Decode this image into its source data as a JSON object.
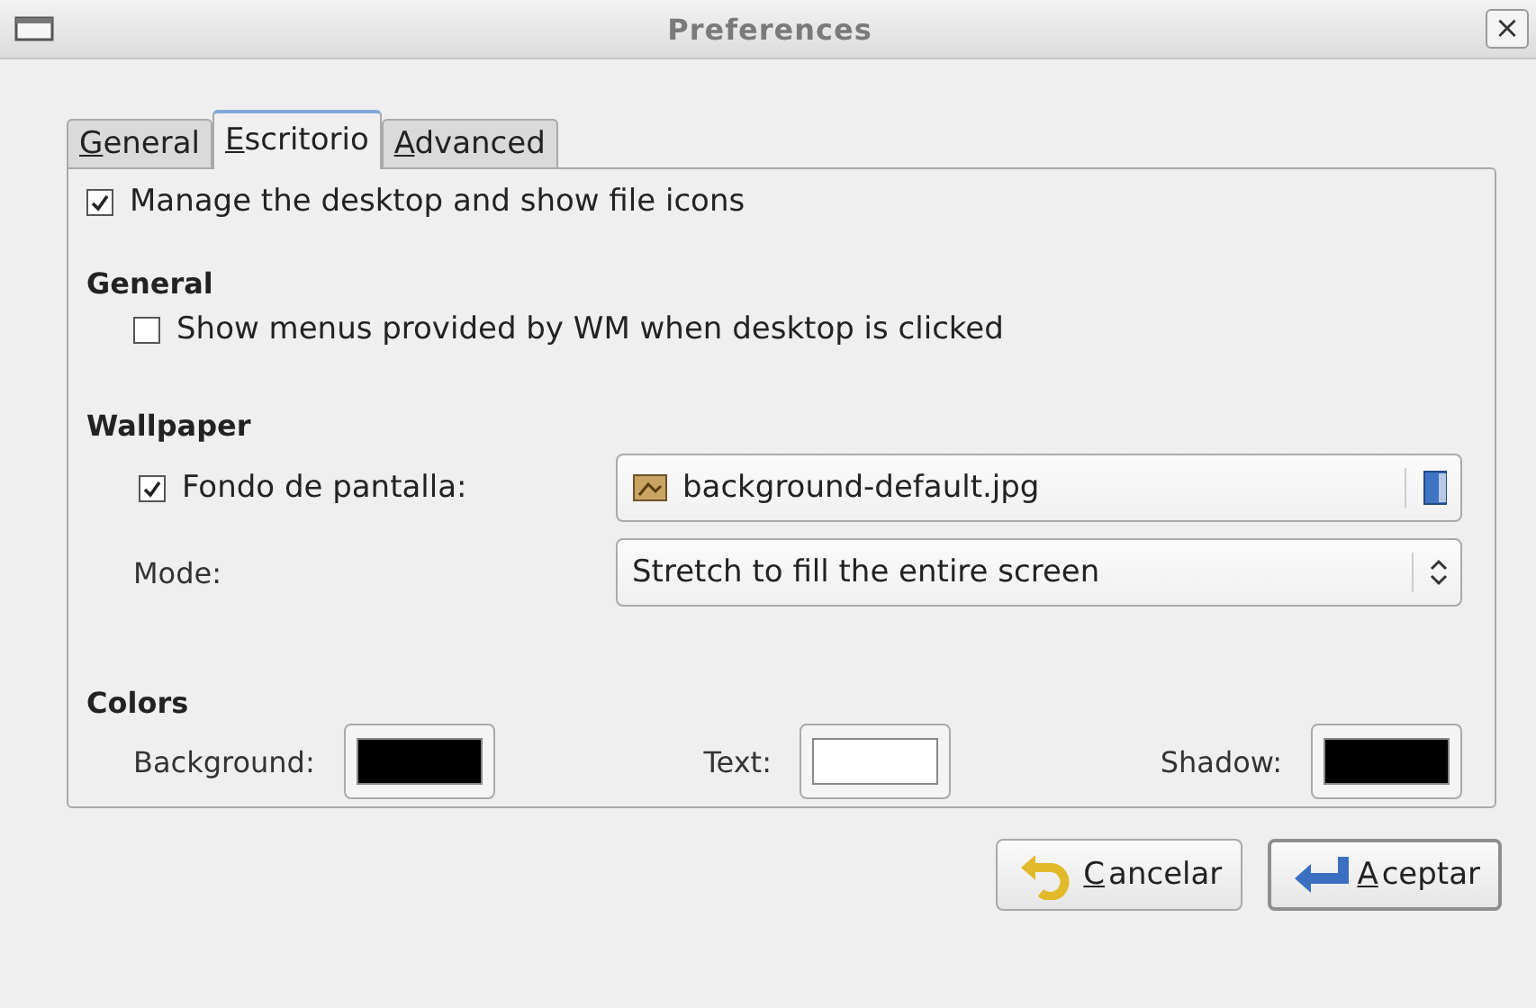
{
  "window": {
    "title": "Preferences",
    "close": "×"
  },
  "tabs": [
    {
      "label": "General",
      "selected": false
    },
    {
      "label": "Escritorio",
      "selected": true
    },
    {
      "label": "Advanced",
      "selected": false
    }
  ],
  "manage_desktop": {
    "label": "Manage the desktop and show file icons",
    "checked": true
  },
  "general": {
    "heading": "General",
    "show_menus": {
      "label": "Show menus provided by WM when desktop is clicked",
      "checked": false
    }
  },
  "wallpaper": {
    "heading": "Wallpaper",
    "enabled": {
      "label": "Fondo de pantalla:",
      "checked": true
    },
    "file": "background-default.jpg",
    "mode_label": "Mode:",
    "mode": "Stretch to fill the entire screen"
  },
  "colors": {
    "heading": "Colors",
    "swatches": [
      {
        "label": "Background:",
        "color": "#000000"
      },
      {
        "label": "Text:",
        "color": "#ffffff"
      },
      {
        "label": "Shadow:",
        "color": "#000000"
      }
    ]
  },
  "buttons": [
    {
      "kind": "cancel",
      "label": "Cancelar",
      "default": false
    },
    {
      "kind": "ok",
      "label": "Aceptar",
      "default": true
    }
  ]
}
